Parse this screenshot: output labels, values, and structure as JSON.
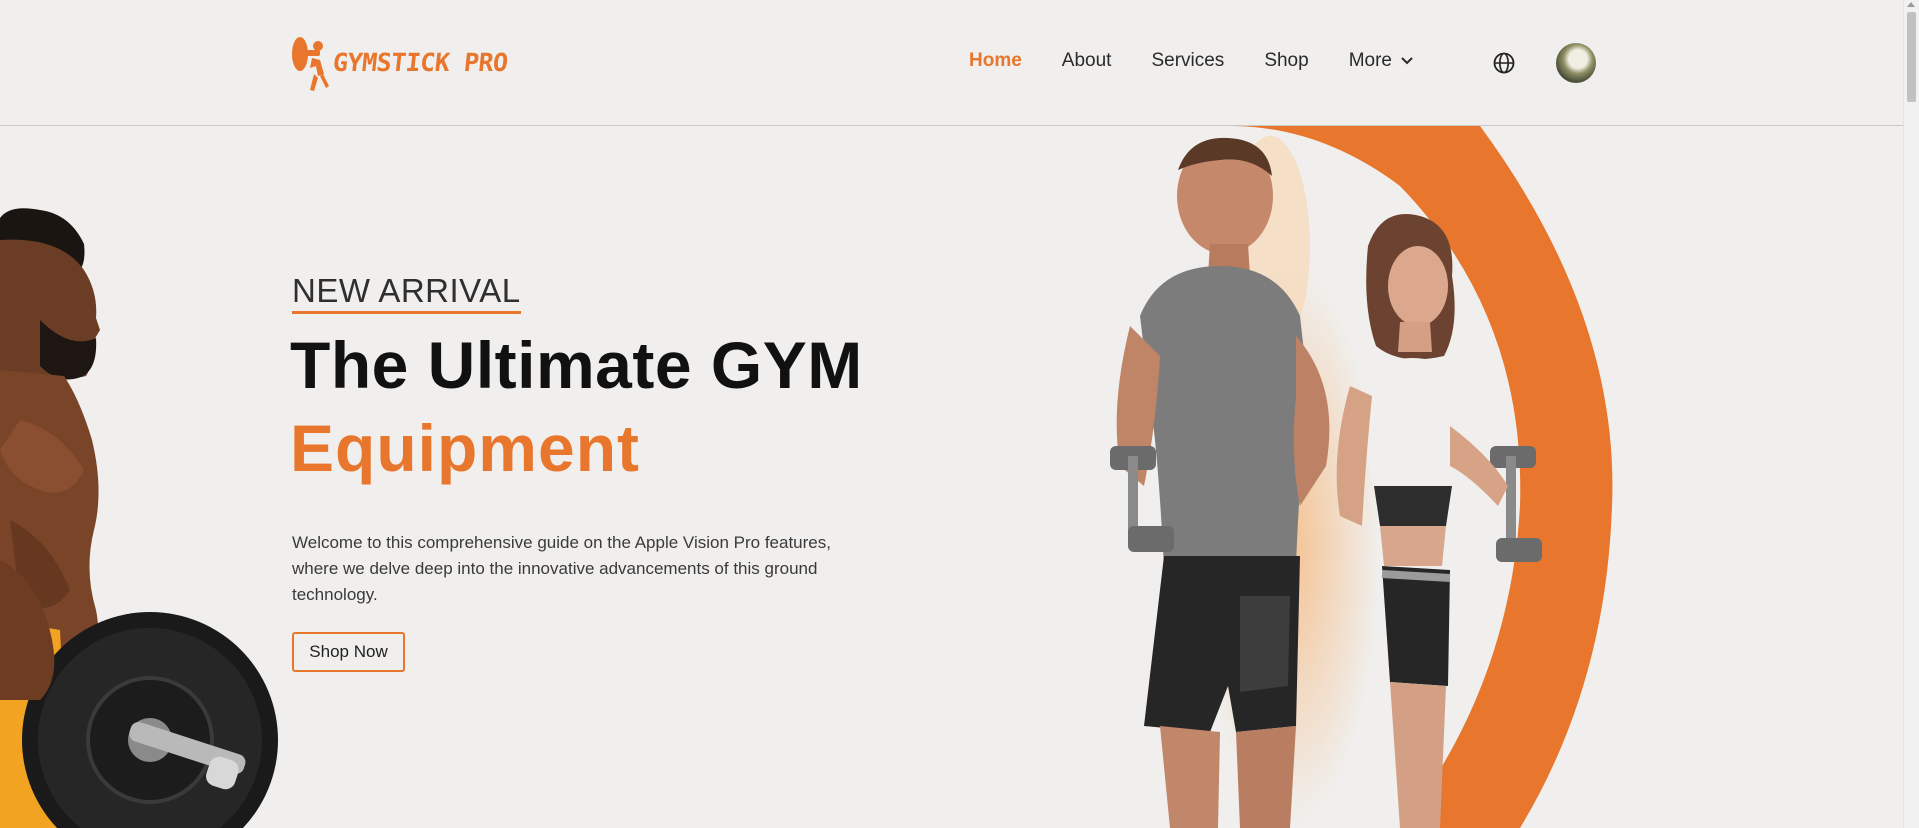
{
  "header": {
    "logo_text": "GYMSTICK PRO",
    "nav": {
      "home": "Home",
      "about": "About",
      "services": "Services",
      "shop": "Shop",
      "more": "More"
    },
    "icons": [
      "globe-icon",
      "chevron-down-icon"
    ]
  },
  "hero": {
    "eyebrow": "NEW ARRIVAL",
    "title_line1": "The Ultimate GYM",
    "title_line2": "Equipment",
    "description": "Welcome to this comprehensive guide on the Apple Vision Pro features, where we delve deep into the innovative advancements of this ground technology.",
    "cta_label": "Shop Now"
  },
  "colors": {
    "accent": "#e8762c",
    "background": "#f0efed",
    "heading": "#111111",
    "text": "#3a3a3a"
  }
}
